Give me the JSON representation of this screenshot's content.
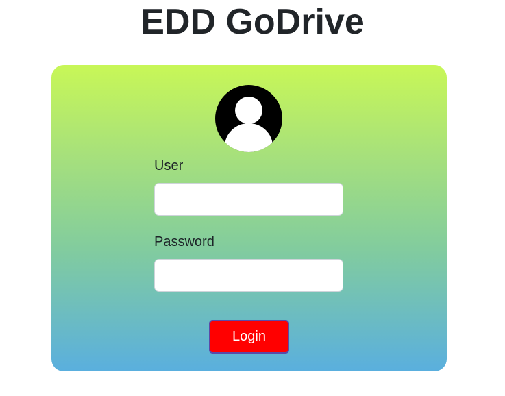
{
  "page": {
    "title": "EDD GoDrive"
  },
  "login_form": {
    "user_label": "User",
    "user_value": "",
    "password_label": "Password",
    "password_value": "",
    "login_button_label": "Login",
    "avatar_icon": "user-avatar-icon"
  },
  "colors": {
    "title_text": "#212529",
    "card_gradient_top": "#c8f757",
    "card_gradient_bottom": "#5aafde",
    "login_button_bg": "#ff0000",
    "login_button_border": "#5a4aa8",
    "login_button_text": "#ffffff",
    "avatar_bg": "#000000"
  }
}
